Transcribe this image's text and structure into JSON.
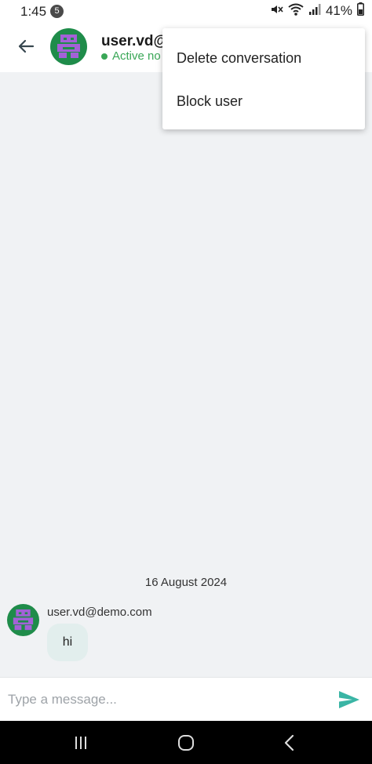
{
  "status_bar": {
    "time": "1:45",
    "notification_count": "5",
    "battery": "41%",
    "icons": [
      "mute-icon",
      "wifi-icon",
      "signal-icon"
    ]
  },
  "header": {
    "back_icon": "arrow-left-icon",
    "user_name": "user.vd@",
    "status": "Active no",
    "status_color": "#3aa757"
  },
  "menu": {
    "items": [
      {
        "label": "Delete conversation"
      },
      {
        "label": "Block user"
      }
    ]
  },
  "chat": {
    "date_separator": "16 August 2024",
    "messages": [
      {
        "sender": "user.vd@demo.com",
        "text": "hi"
      }
    ],
    "background": "#f0f2f4",
    "bubble_color": "#e2eeed"
  },
  "composer": {
    "placeholder": "Type a message...",
    "send_icon": "send-icon",
    "accent": "#3ab5a5"
  },
  "nav_bar": {
    "icons": [
      "recents-icon",
      "home-icon",
      "back-nav-icon"
    ]
  },
  "avatar": {
    "background": "#1f8c4a",
    "figure_color": "#a461d8"
  }
}
